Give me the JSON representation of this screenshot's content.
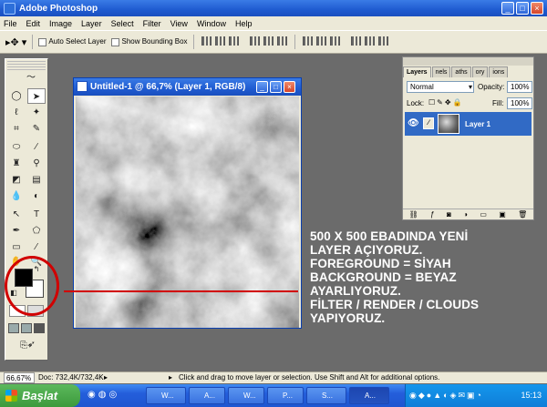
{
  "window": {
    "title": "Adobe Photoshop"
  },
  "menu": [
    "File",
    "Edit",
    "Image",
    "Layer",
    "Select",
    "Filter",
    "View",
    "Window",
    "Help"
  ],
  "options": {
    "auto_select": "Auto Select Layer",
    "show_bounding": "Show Bounding Box"
  },
  "document": {
    "title": "Untitled-1 @ 66,7% (Layer 1, RGB/8)"
  },
  "layers_panel": {
    "tabs": [
      "Layers",
      "nels",
      "aths",
      "ory",
      "ions"
    ],
    "blend_mode": "Normal",
    "opacity_label": "Opacity:",
    "opacity_value": "100%",
    "lock_label": "Lock:",
    "fill_label": "Fill:",
    "fill_value": "100%",
    "layer_name": "Layer 1"
  },
  "annotation": [
    "500 X 500 EBADINDA YENİ",
    "LAYER AÇIYORUZ.",
    "FOREGROUND = SİYAH",
    "BACKGROUND = BEYAZ",
    "AYARLIYORUZ.",
    "FİLTER / RENDER / CLOUDS",
    "YAPIYORUZ."
  ],
  "statusbar": {
    "zoom": "66,67%",
    "doc": "Doc: 732,4K/732,4K",
    "hint": "Click and drag to move layer or selection.  Use Shift and Alt for additional options."
  },
  "taskbar": {
    "start": "Başlat",
    "tasks": [
      "W...",
      "A...",
      "W...",
      "P...",
      "S...",
      "A..."
    ],
    "clock": "15:13"
  },
  "colors": {
    "foreground": "#000000",
    "background": "#ffffff",
    "annotation_highlight": "#d10000"
  }
}
